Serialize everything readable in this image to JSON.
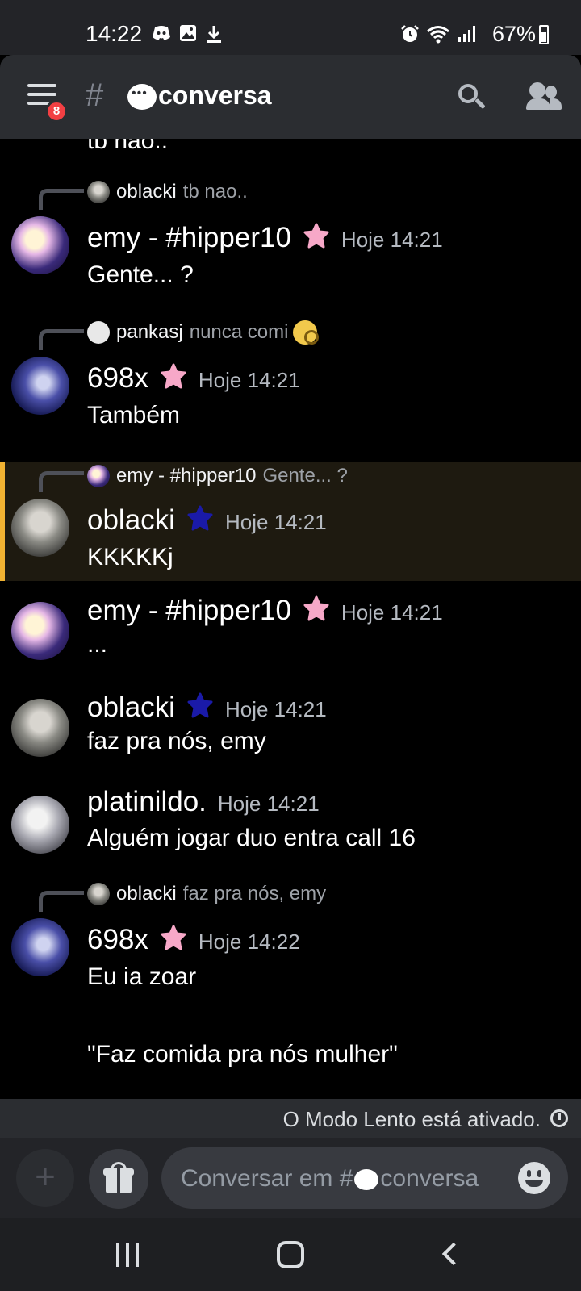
{
  "status_bar": {
    "time": "14:22",
    "battery": "67%",
    "left_icons": [
      "discord-icon",
      "image-icon",
      "download-icon"
    ],
    "right_icons": [
      "alarm-icon",
      "wifi-icon",
      "signal-icon",
      "battery-icon"
    ]
  },
  "header": {
    "menu_badge": "8",
    "channel_name": "conversa",
    "icons": [
      "menu-icon",
      "hash-icon",
      "speech-bubble-icon",
      "search-icon",
      "members-icon"
    ]
  },
  "messages": [
    {
      "kind": "fragment",
      "content": "tb nao.."
    },
    {
      "reply_to": {
        "name": "oblacki",
        "text": "tb nao.."
      },
      "author": "emy - #hipper10",
      "badge": "pink-flower-icon",
      "time": "Hoje 14:21",
      "content": "Gente... ?"
    },
    {
      "reply_to": {
        "name": "pankasj",
        "text": "nunca comi"
      },
      "author": "698x",
      "badge": "pink-flower-icon",
      "time": "Hoje 14:21",
      "content": "Também"
    },
    {
      "reply_to": {
        "name": "emy - #hipper10",
        "text": "Gente... ?"
      },
      "author": "oblacki",
      "badge": "blue-flower-icon",
      "time": "Hoje 14:21",
      "content": "KKKKKj",
      "highlighted": true
    },
    {
      "author": "emy - #hipper10",
      "badge": "pink-flower-icon",
      "time": "Hoje 14:21",
      "content": "..."
    },
    {
      "author": "oblacki",
      "badge": "blue-flower-icon",
      "time": "Hoje 14:21",
      "content": "faz pra nós, emy"
    },
    {
      "author": "platinildo.",
      "time": "Hoje 14:21",
      "content": "Alguém jogar duo entra call 16"
    },
    {
      "reply_to": {
        "name": "oblacki",
        "text": "faz pra nós, emy"
      },
      "author": "698x",
      "badge": "pink-flower-icon",
      "time": "Hoje 14:22",
      "content_lines": [
        "Eu ia zoar",
        "",
        "\"Faz comida pra nós mulher\""
      ]
    }
  ],
  "slow_mode": {
    "text": "O Modo Lento está ativado."
  },
  "composer": {
    "placeholder": "Conversar em #",
    "placeholder_channel": "conversa"
  },
  "colors": {
    "accent_highlight": "#f0b232",
    "pink_badge": "#f7a8c8",
    "blue_badge": "#1a1aa8",
    "mention_badge": "#f23f43"
  }
}
